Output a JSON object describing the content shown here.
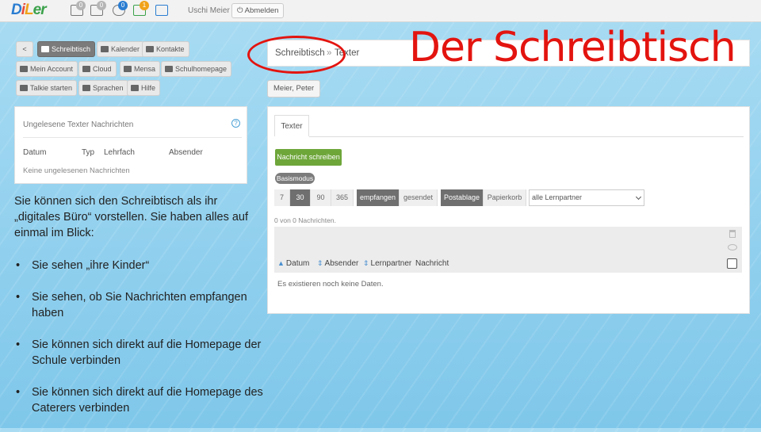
{
  "topbar": {
    "logo": [
      "D",
      "i",
      "L",
      "er"
    ],
    "badges": [
      "0",
      "0",
      "0",
      "1"
    ],
    "user": "Uschi Meier",
    "logout": "Abmelden"
  },
  "nav": {
    "back": "<",
    "tabs": [
      {
        "label": "Schreibtisch",
        "icon": "monitor-icon",
        "active": true
      },
      {
        "label": "Kalender",
        "icon": "calendar-icon"
      },
      {
        "label": "Kontakte",
        "icon": "contacts-icon"
      }
    ],
    "row2": [
      {
        "label": "Mein Account",
        "icon": "user-icon"
      },
      {
        "label": "Cloud",
        "icon": "cloud-icon"
      },
      {
        "label": "Mensa",
        "icon": "food-icon"
      },
      {
        "label": "Schulhomepage",
        "icon": "school-icon"
      }
    ],
    "row3": [
      {
        "label": "Talkie starten",
        "icon": "chat-icon"
      },
      {
        "label": "Sprachen",
        "icon": "flag-icon"
      },
      {
        "label": "Hilfe",
        "icon": "help-icon"
      }
    ]
  },
  "unread_panel": {
    "title": "Ungelesene Texter Nachrichten",
    "help": "?",
    "columns": [
      "Datum",
      "Typ",
      "Lehrfach",
      "Absender"
    ],
    "empty": "Keine ungelesenen Nachrichten"
  },
  "slide": {
    "title": "Der Schreibtisch",
    "intro": "Sie können sich den Schreibtisch als ihr „digitales Büro“ vorstellen. Sie haben alles auf einmal im Blick:",
    "bullets": [
      "Sie sehen „ihre Kinder“",
      "Sie sehen, ob Sie Nachrichten empfangen haben",
      "Sie können sich direkt auf die Homepage der Schule verbinden",
      "Sie können sich direkt auf die Homepage des Caterers verbinden"
    ]
  },
  "breadcrumb": {
    "first": "Schreibtisch",
    "sep": "»",
    "second": "Texter"
  },
  "child_button": "Meier, Peter",
  "texter": {
    "tab": "Texter",
    "compose": "Nachricht schreiben",
    "mode": "Basismodus",
    "days": [
      "7",
      "30",
      "90",
      "365"
    ],
    "days_active": "30",
    "filters": [
      "empfangen",
      "gesendet"
    ],
    "filter_active": "empfangen",
    "folders": [
      "Postablage",
      "Papierkorb"
    ],
    "folder_active": "Postablage",
    "partner_select": "alle Lernpartner",
    "count": "0 von 0 Nachrichten.",
    "columns": [
      "Datum",
      "Absender",
      "Lernpartner",
      "Nachricht"
    ],
    "empty": "Es existieren noch keine Daten."
  }
}
